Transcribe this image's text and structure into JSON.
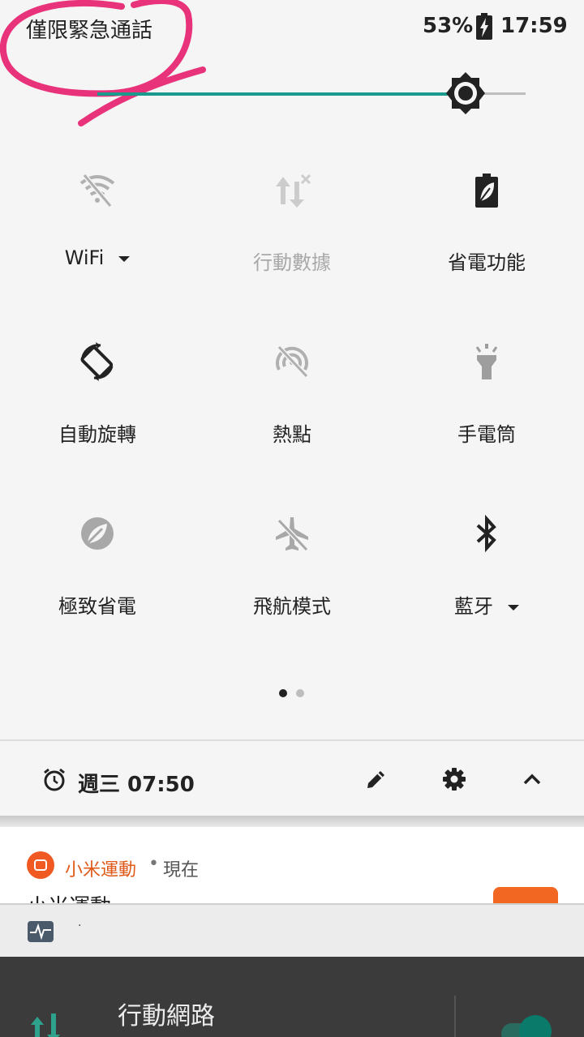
{
  "status_bar": {
    "carrier_text": "僅限緊急通話",
    "battery_percent": "53%",
    "time": "17:59"
  },
  "brightness": {
    "level": 0.86
  },
  "quick_settings": {
    "wifi": {
      "label": "WiFi",
      "state": "off"
    },
    "mobile_data": {
      "label": "行動數據",
      "state": "disabled"
    },
    "battery_saver": {
      "label": "省電功能",
      "state": "on"
    },
    "auto_rotate": {
      "label": "自動旋轉",
      "state": "on"
    },
    "hotspot": {
      "label": "熱點",
      "state": "off"
    },
    "flashlight": {
      "label": "手電筒",
      "state": "off"
    },
    "extreme_saver": {
      "label": "極致省電",
      "state": "off"
    },
    "airplane_mode": {
      "label": "飛航模式",
      "state": "off"
    },
    "bluetooth": {
      "label": "藍牙",
      "state": "on"
    }
  },
  "pager": {
    "current_page": 1,
    "page_count": 2
  },
  "footer": {
    "alarm_text": "週三 07:50"
  },
  "notification": {
    "app_name": "小米運動",
    "separator": "•",
    "time": "現在",
    "title": "小米運動"
  },
  "notification2": {
    "text": "·"
  },
  "network_panel": {
    "title": "行動網路"
  },
  "colors": {
    "accent": "#1a9a8c",
    "icon_dark": "#222222",
    "icon_disabled": "#b0b0b0",
    "mi_orange": "#f05a22",
    "annotation_pink": "#e8327a"
  }
}
